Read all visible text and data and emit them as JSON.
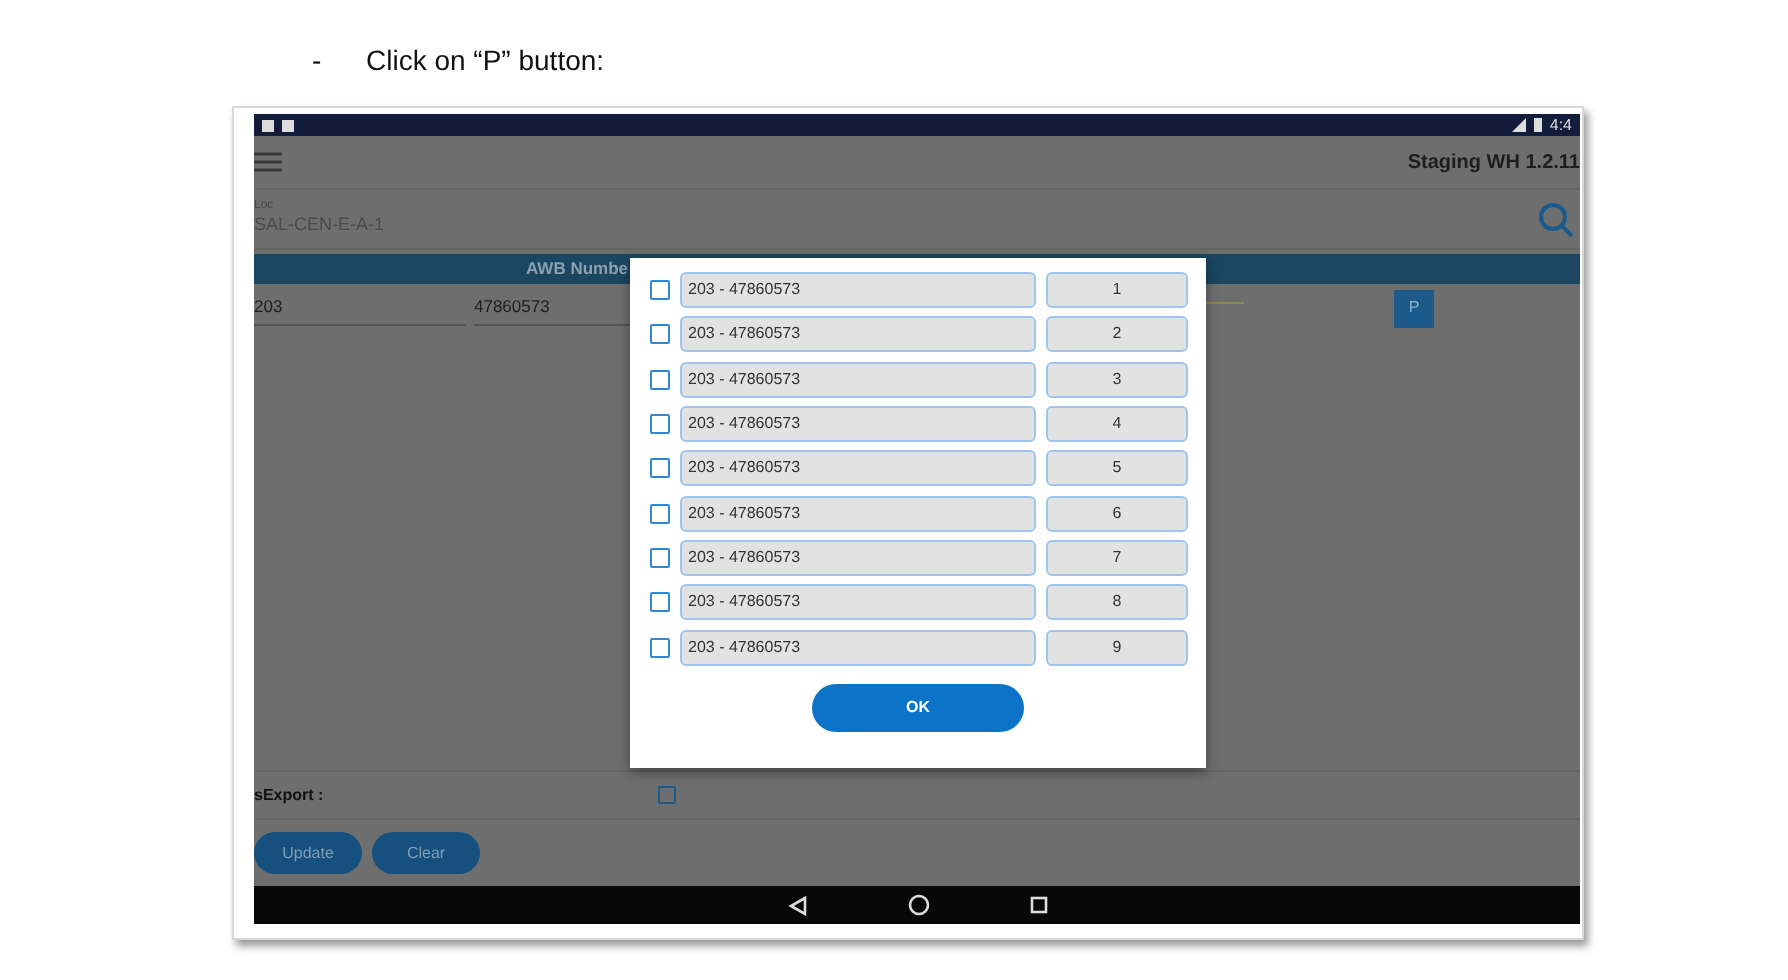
{
  "instruction": {
    "bullet": "-",
    "text": "Click on “P” button:"
  },
  "status_bar": {
    "time": "4:4"
  },
  "app_bar": {
    "title": "Staging WH 1.2.11"
  },
  "location": {
    "label": "Loc",
    "value": "SAL-CEN-E-A-1"
  },
  "table": {
    "header": "AWB Numbe",
    "row": {
      "prefix": "203",
      "number": "47860573",
      "button": "P"
    }
  },
  "export_field": {
    "label": "sExport :",
    "checked": false
  },
  "buttons": [
    "Update",
    "Clear"
  ],
  "dialog": {
    "items": [
      {
        "awb": "203 - 47860573",
        "piece": "1",
        "checked": false
      },
      {
        "awb": "203 - 47860573",
        "piece": "2",
        "checked": false
      },
      {
        "awb": "203 - 47860573",
        "piece": "3",
        "checked": false
      },
      {
        "awb": "203 - 47860573",
        "piece": "4",
        "checked": false
      },
      {
        "awb": "203 - 47860573",
        "piece": "5",
        "checked": false
      },
      {
        "awb": "203 - 47860573",
        "piece": "6",
        "checked": false
      },
      {
        "awb": "203 - 47860573",
        "piece": "7",
        "checked": false
      },
      {
        "awb": "203 - 47860573",
        "piece": "8",
        "checked": false
      },
      {
        "awb": "203 - 47860573",
        "piece": "9",
        "checked": false
      }
    ],
    "ok_button": "OK"
  }
}
